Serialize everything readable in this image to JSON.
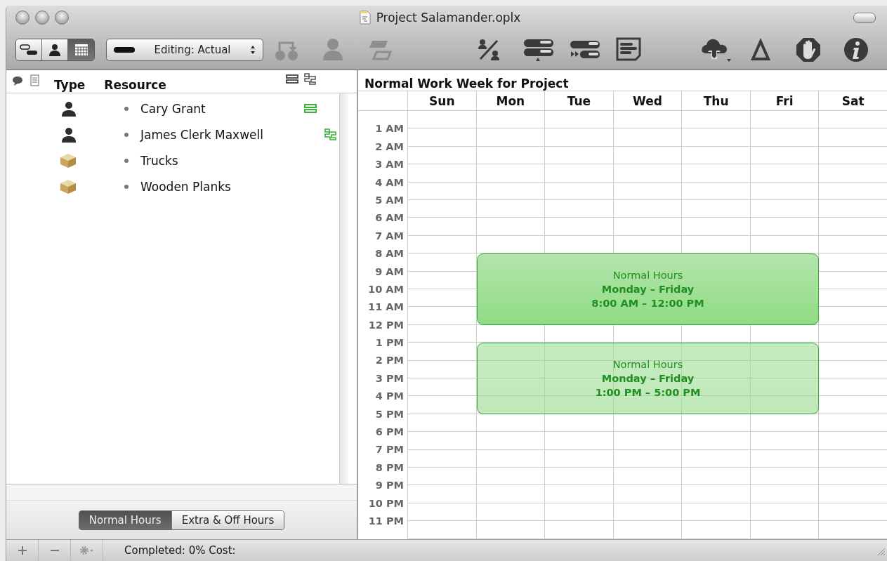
{
  "window": {
    "title": "Project Salamander.oplx"
  },
  "toolbar": {
    "view_buttons": [
      {
        "kind": "gantt",
        "selected": false
      },
      {
        "kind": "resources",
        "selected": false
      },
      {
        "kind": "calendar",
        "selected": true
      }
    ],
    "editing_popup": {
      "label": "Editing: Actual"
    },
    "tool_groups": [
      [
        {
          "kind": "connect",
          "disabled": true
        },
        {
          "kind": "person",
          "disabled": true
        },
        {
          "kind": "split",
          "disabled": true
        }
      ],
      [
        {
          "kind": "assign",
          "disabled": false
        },
        {
          "kind": "group",
          "disabled": false
        },
        {
          "kind": "level",
          "disabled": false
        },
        {
          "kind": "note",
          "disabled": false
        }
      ],
      [
        {
          "kind": "publish",
          "disabled": false
        },
        {
          "kind": "delta",
          "disabled": false
        },
        {
          "kind": "stop",
          "disabled": false
        },
        {
          "kind": "info",
          "disabled": false
        }
      ]
    ]
  },
  "resources": {
    "columns": [
      "Type",
      "Resource"
    ],
    "rows": [
      {
        "name": "Cary Grant",
        "kind": "person",
        "project_calendar": true,
        "custom_calendar": false
      },
      {
        "name": "James Clerk Maxwell",
        "kind": "person",
        "project_calendar": false,
        "custom_calendar": true
      },
      {
        "name": "Trucks",
        "kind": "material",
        "project_calendar": false,
        "custom_calendar": false
      },
      {
        "name": "Wooden Planks",
        "kind": "material",
        "project_calendar": false,
        "custom_calendar": false
      }
    ]
  },
  "hours_switch": [
    {
      "label": "Normal Hours",
      "selected": true
    },
    {
      "label": "Extra & Off Hours",
      "selected": false
    }
  ],
  "status_bar": {
    "text": "Completed: 0% Cost:"
  },
  "calendar": {
    "title": "Normal Work Week for Project",
    "days": [
      "Sun",
      "Mon",
      "Tue",
      "Wed",
      "Thu",
      "Fri",
      "Sat"
    ],
    "hours": [
      "1 AM",
      "2 AM",
      "3 AM",
      "4 AM",
      "5 AM",
      "6 AM",
      "7 AM",
      "8 AM",
      "9 AM",
      "10 AM",
      "11 AM",
      "12 PM",
      "1 PM",
      "2 PM",
      "3 PM",
      "4 PM",
      "5 PM",
      "6 PM",
      "7 PM",
      "8 PM",
      "9 PM",
      "10 PM",
      "11 PM"
    ],
    "blocks": [
      {
        "title": "Normal Hours",
        "days": "Monday – Friday",
        "times": "8:00 AM – 12:00 PM",
        "selected": true
      },
      {
        "title": "Normal Hours",
        "days": "Monday – Friday",
        "times": "1:00 PM – 5:00 PM",
        "selected": false
      }
    ]
  }
}
